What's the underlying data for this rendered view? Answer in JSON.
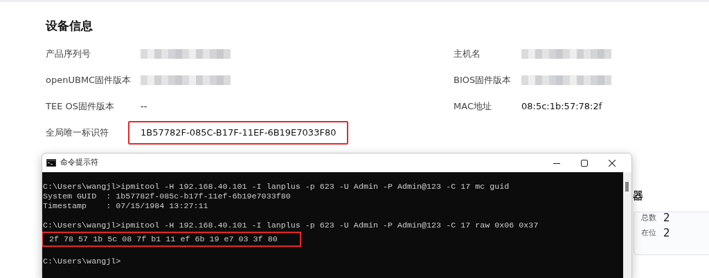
{
  "section": {
    "title": "设备信息"
  },
  "left_fields": [
    {
      "label": "产品序列号",
      "redacted": true,
      "highlighted": false
    },
    {
      "label": "openUBMC固件版本",
      "redacted": true,
      "highlighted": false
    },
    {
      "label": "TEE OS固件版本",
      "redacted": false,
      "value": "--",
      "highlighted": false
    },
    {
      "label": "全局唯一标识符",
      "redacted": false,
      "value": "1B57782F-085C-B17F-11EF-6B19E7033F80",
      "highlighted": true
    }
  ],
  "right_fields": [
    {
      "label": "主机名",
      "redacted": true,
      "highlighted": false
    },
    {
      "label": "BIOS固件版本",
      "redacted": true,
      "highlighted": false
    },
    {
      "label": "MAC地址",
      "redacted": false,
      "value": "08:5c:1b:57:78:2f",
      "highlighted": false
    }
  ],
  "side_panel": {
    "title_fragment": "器",
    "stats": [
      {
        "label": "总数",
        "value": "2"
      },
      {
        "label": "在位",
        "value": "2"
      }
    ]
  },
  "terminal": {
    "title": "命令提示符",
    "lines": [
      {
        "highlighted": false
      },
      {
        "text": "C:\\Users\\wangjl>ipmitool -H 192.168.40.101 -I lanplus -p 623 -U Admin -P Admin@123 -C 17 mc guid",
        "highlighted": false
      },
      {
        "text": "System GUID  : 1b57782f-085c-b17f-11ef-6b19e7033f80",
        "highlighted": false
      },
      {
        "text": "Timestamp    : 07/15/1984 13:27:11",
        "highlighted": false
      },
      {
        "highlighted": false
      },
      {
        "text": "C:\\Users\\wangjl>ipmitool -H 192.168.40.101 -I lanplus -p 623 -U Admin -P Admin@123 -C 17 raw 0x06 0x37",
        "highlighted": false
      },
      {
        "text": " 2f 78 57 1b 5c 08 7f b1 11 ef 6b 19 e7 03 3f 80",
        "highlighted": true
      },
      {
        "highlighted": false
      },
      {
        "text": "C:\\Users\\wangjl>",
        "highlighted": false
      }
    ]
  }
}
